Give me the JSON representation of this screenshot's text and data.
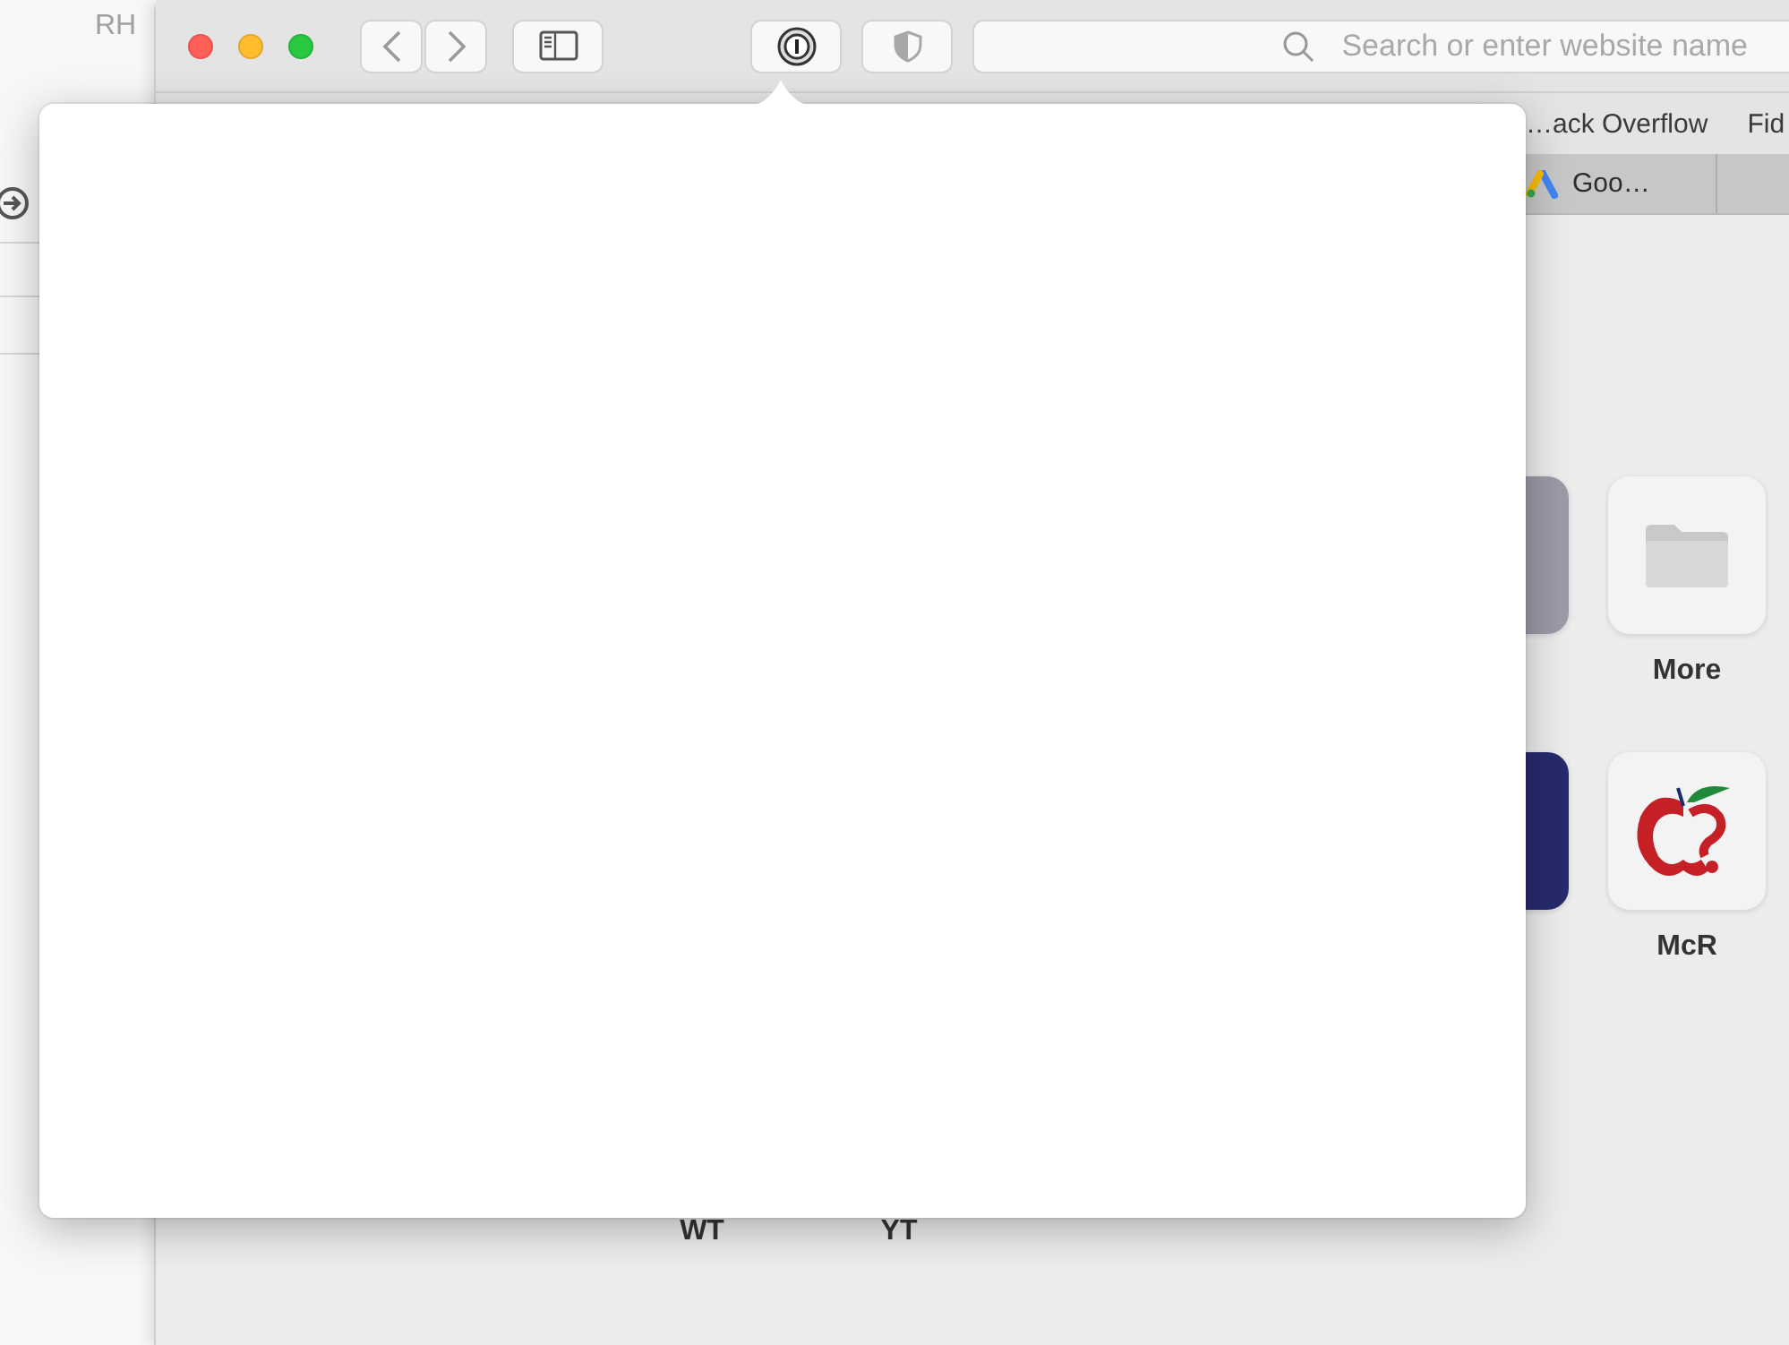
{
  "background_window": {
    "title": "RH"
  },
  "toolbar": {
    "search": {
      "placeholder": "Search or enter website name"
    }
  },
  "bookmarks": [
    "…ack Overflow",
    "Fid"
  ],
  "tabs": [
    {
      "label": "Goo…",
      "selected": false
    }
  ],
  "favorites": [
    [
      {
        "kind": "empty"
      },
      {
        "kind": "empty"
      },
      {
        "kind": "empty"
      },
      {
        "kind": "empty"
      },
      {
        "kind": "tile",
        "color": "#9a9aa8"
      },
      {
        "kind": "folder",
        "label": "More"
      }
    ],
    [
      {
        "kind": "empty"
      },
      {
        "kind": "empty"
      },
      {
        "kind": "empty"
      },
      {
        "kind": "empty"
      },
      {
        "kind": "tile",
        "color": "#272a6b"
      },
      {
        "kind": "logo",
        "label": "McR"
      }
    ],
    [
      {
        "kind": "label",
        "label": "WT"
      },
      {
        "kind": "label",
        "label": "YT"
      }
    ]
  ]
}
